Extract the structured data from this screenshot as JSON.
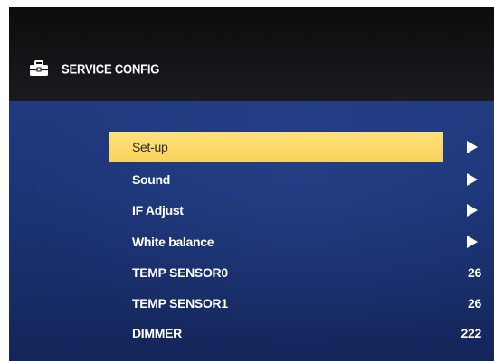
{
  "header": {
    "icon": "toolbox-icon",
    "title": "SERVICE CONFIG"
  },
  "menu": {
    "items": [
      {
        "label": "Set-up",
        "type": "submenu",
        "selected": true
      },
      {
        "label": "Sound",
        "type": "submenu",
        "selected": false
      },
      {
        "label": "IF Adjust",
        "type": "submenu",
        "selected": false
      },
      {
        "label": "White balance",
        "type": "submenu",
        "selected": false
      },
      {
        "label": "TEMP SENSOR0",
        "type": "value",
        "value": "26",
        "selected": false
      },
      {
        "label": "TEMP SENSOR1",
        "type": "value",
        "value": "26",
        "selected": false
      },
      {
        "label": "DIMMER",
        "type": "value",
        "value": "222",
        "selected": false
      }
    ]
  },
  "colors": {
    "background_blue": "#1c3577",
    "header_black": "#141417",
    "highlight_yellow": "#f7d25c",
    "text_white": "#ffffff",
    "selected_text": "#2a2a2a"
  },
  "icons": {
    "submenu_arrow": "play-arrow-icon"
  }
}
